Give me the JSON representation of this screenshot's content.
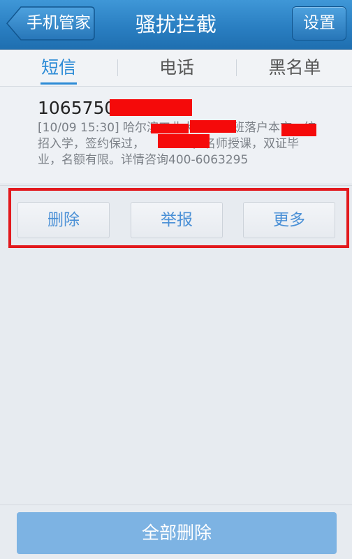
{
  "header": {
    "back_label": "手机管家",
    "title": "骚扰拦截",
    "settings_label": "设置"
  },
  "tabs": [
    {
      "label": "短信",
      "active": true
    },
    {
      "label": "电话",
      "active": false
    },
    {
      "label": "黑名单",
      "active": false
    }
  ],
  "message": {
    "sender_visible": "10657502",
    "line1": "[10/09 15:30]  哈尔滨工业大学MBA班落户本市，统",
    "line2": "招入学，签约保过，",
    "line2b": "，名师授课，双证毕",
    "line3": "业，名额有限。详情咨询400-6063295"
  },
  "actions": {
    "delete_label": "删除",
    "report_label": "举报",
    "more_label": "更多"
  },
  "footer": {
    "delete_all_label": "全部删除"
  },
  "colors": {
    "accent": "#2c8bd6",
    "header": "#2a7fc2",
    "highlight_box": "#e2191d",
    "redaction": "#f50a0a"
  }
}
